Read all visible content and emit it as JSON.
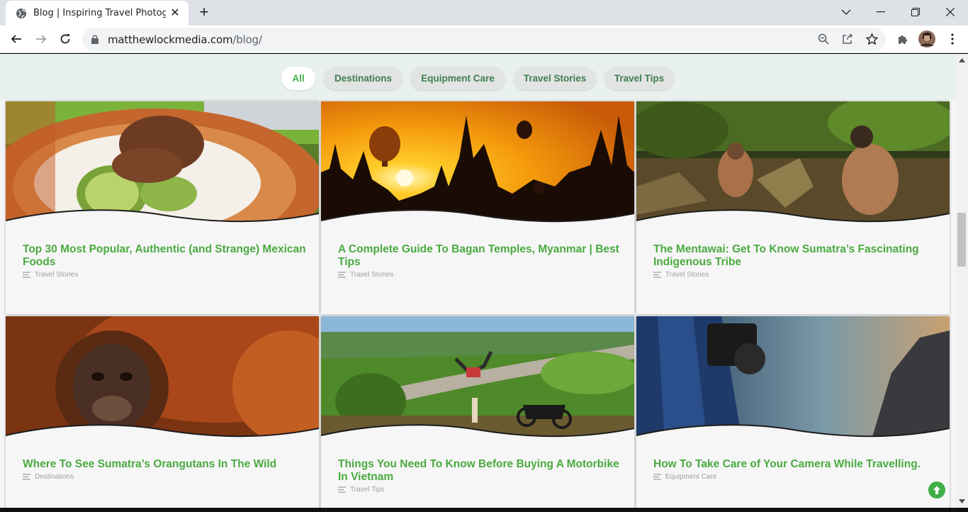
{
  "browser": {
    "tab_title": "Blog | Inspiring Travel Photograp",
    "url_host": "matthewlockmedia.com",
    "url_path": "/blog/",
    "icons": [
      "globe-icon",
      "close-icon",
      "plus-icon",
      "chevron-down-icon",
      "minimize-icon",
      "restore-icon",
      "close-window-icon",
      "back-icon",
      "forward-icon",
      "reload-icon",
      "lock-icon",
      "zoom-icon",
      "share-icon",
      "star-icon",
      "extensions-icon",
      "avatar",
      "kebab-menu-icon"
    ]
  },
  "filters": [
    {
      "label": "All",
      "active": true
    },
    {
      "label": "Destinations",
      "active": false
    },
    {
      "label": "Equipment Care",
      "active": false
    },
    {
      "label": "Travel Stories",
      "active": false
    },
    {
      "label": "Travel Tips",
      "active": false
    }
  ],
  "posts": [
    {
      "title": "Top 30 Most Popular, Authentic (and Strange) Mexican Foods",
      "category": "Travel Stories"
    },
    {
      "title": "A Complete Guide To Bagan Temples, Myanmar | Best Tips",
      "category": "Travel Stories"
    },
    {
      "title": "The Mentawai: Get To Know Sumatra’s Fascinating Indigenous Tribe",
      "category": "Travel Stories"
    },
    {
      "title": "Where To See Sumatra’s Orangutans In The Wild",
      "category": "Destinations"
    },
    {
      "title": "Things You Need To Know Before Buying A Motorbike In Vietnam",
      "category": "Travel Tips"
    },
    {
      "title": "How To Take Care of Your Camera While Travelling.",
      "category": "Equipment Care"
    }
  ],
  "colors": {
    "accent": "#42b049",
    "filter_bg": "#e9f1ee",
    "title_green": "#4aaa3f"
  }
}
